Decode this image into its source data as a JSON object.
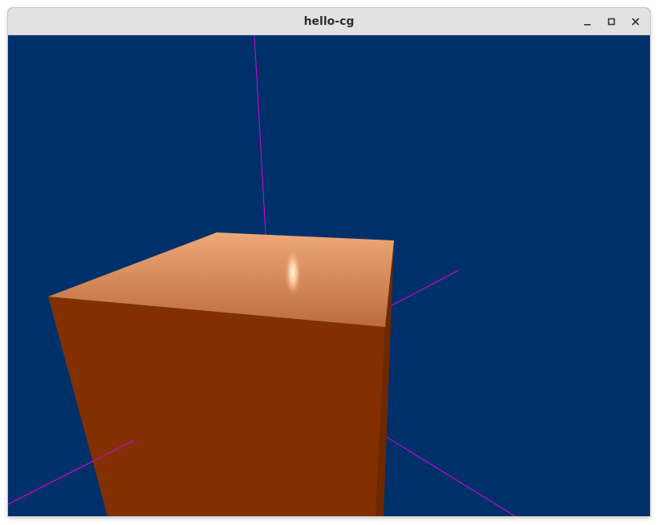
{
  "window": {
    "title": "hello-cg"
  },
  "titlebar_controls": [
    {
      "name": "minimize",
      "icon": "minimize-icon"
    },
    {
      "name": "maximize",
      "icon": "maximize-icon"
    },
    {
      "name": "close",
      "icon": "close-icon"
    }
  ],
  "scene": {
    "background_color": "#00306a",
    "cube_front_color": "#823000",
    "cube_top_color_light": "#e8a070",
    "cube_top_color_dark": "#c07040",
    "specular_highlight_color": "#fff4d8",
    "axis_color": "#e000e0"
  }
}
